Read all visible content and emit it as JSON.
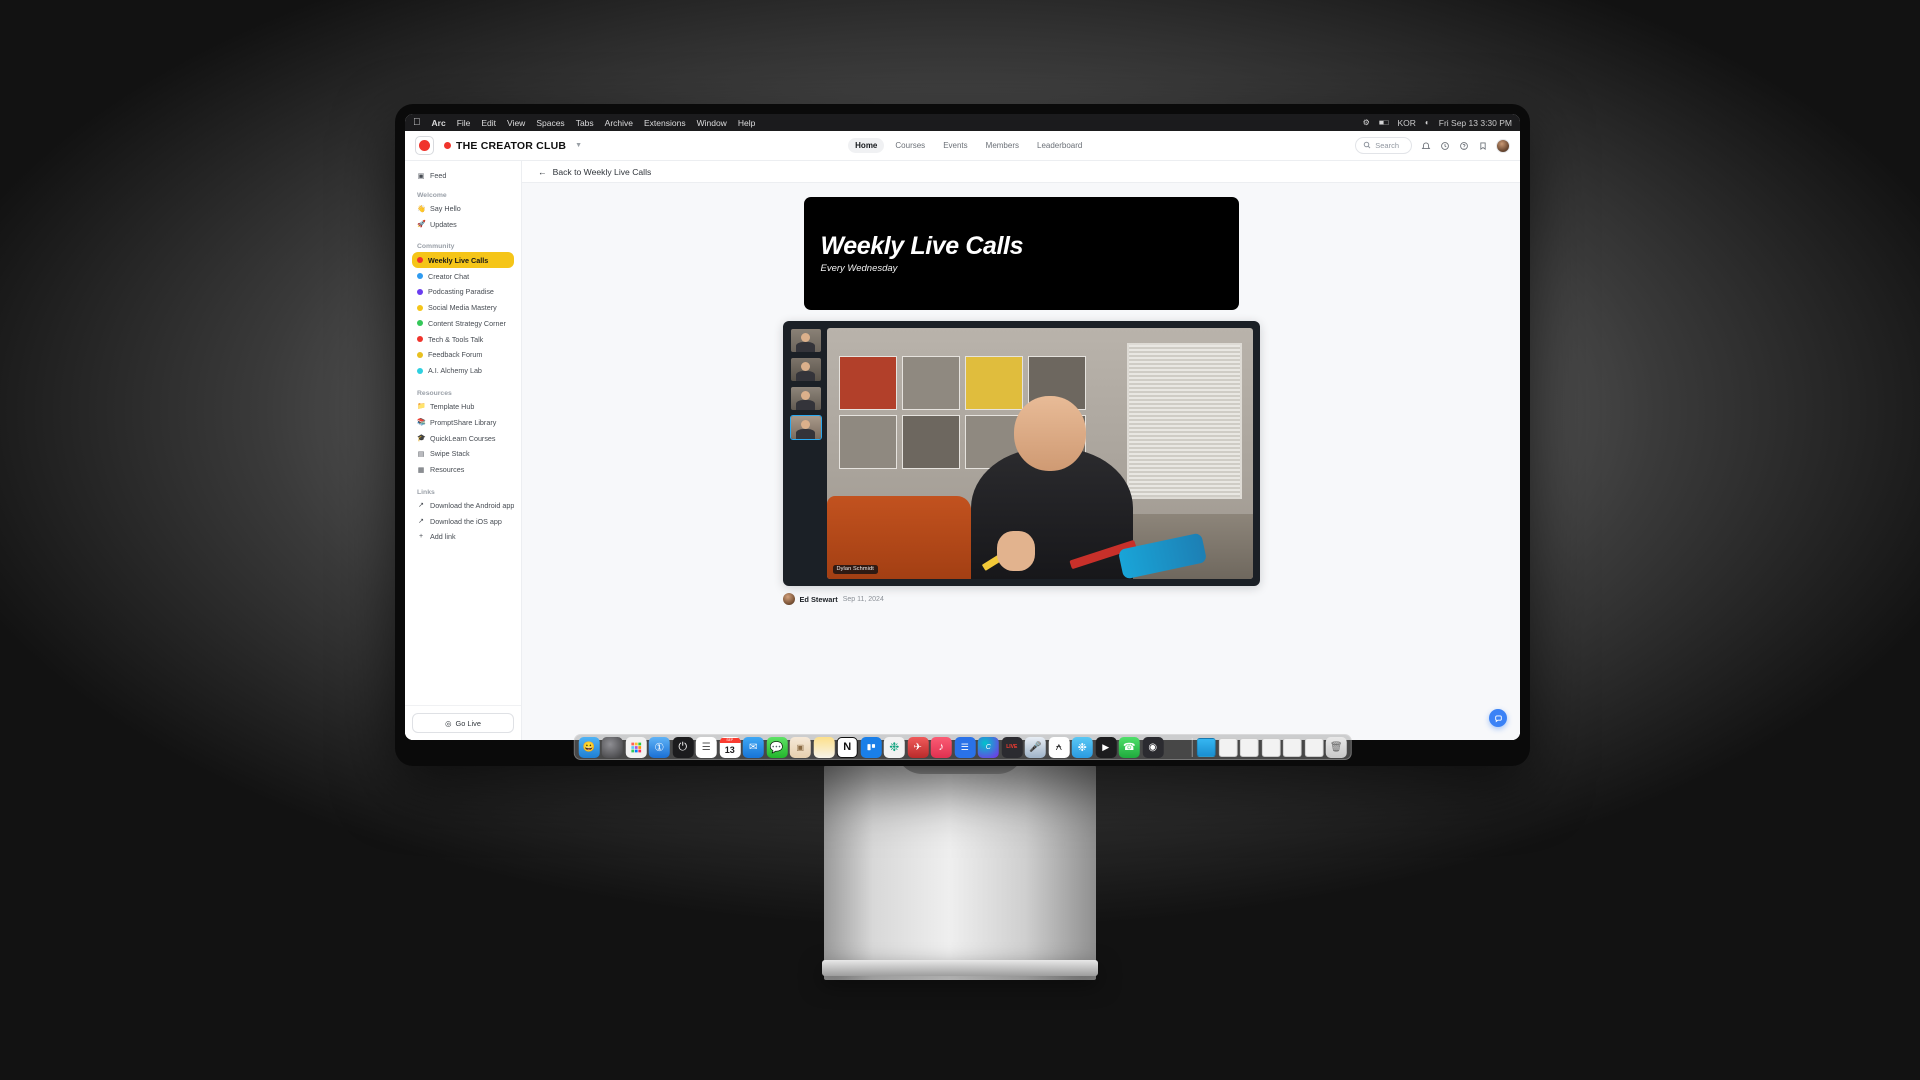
{
  "menubar": {
    "apple_icon": "apple-icon",
    "items": [
      "Arc",
      "File",
      "Edit",
      "View",
      "Spaces",
      "Tabs",
      "Archive",
      "Extensions",
      "Window",
      "Help"
    ],
    "status": {
      "battery_icon": "battery-icon",
      "control_center_icon": "control-center-icon",
      "wifi_icon": "wifi-icon",
      "input_label": "KOR",
      "datetime": "Fri Sep 13  3:30 PM"
    }
  },
  "app": {
    "brand": {
      "logo_icon": "record-dot-logo",
      "name": "THE CREATOR CLUB",
      "caret_icon": "chevron-down-icon"
    },
    "topnav": [
      {
        "label": "Home",
        "active": true
      },
      {
        "label": "Courses",
        "active": false
      },
      {
        "label": "Events",
        "active": false
      },
      {
        "label": "Members",
        "active": false
      },
      {
        "label": "Leaderboard",
        "active": false
      }
    ],
    "topright": {
      "search_placeholder": "Search",
      "search_icon": "search-icon",
      "icons": [
        "notifications-icon",
        "activity-icon",
        "help-icon",
        "bookmark-icon"
      ],
      "avatar": "user-avatar"
    }
  },
  "sidebar": {
    "feed": {
      "label": "Feed",
      "icon": "feed-icon"
    },
    "groups": [
      {
        "title": "Welcome",
        "items": [
          {
            "label": "Say Hello",
            "icon": "wave-emoji",
            "color": "#f5c518",
            "active": false
          },
          {
            "label": "Updates",
            "icon": "rocket-emoji",
            "color": "#e2503c",
            "active": false
          }
        ]
      },
      {
        "title": "Community",
        "items": [
          {
            "label": "Weekly Live Calls",
            "icon": "dot",
            "color": "#f0342c",
            "active": true
          },
          {
            "label": "Creator Chat",
            "icon": "dot",
            "color": "#2f9bf0",
            "active": false
          },
          {
            "label": "Podcasting Paradise",
            "icon": "dot",
            "color": "#6b3df0",
            "active": false
          },
          {
            "label": "Social Media Mastery",
            "icon": "dot",
            "color": "#f5c518",
            "active": false
          },
          {
            "label": "Content Strategy Corner",
            "icon": "dot",
            "color": "#34c759",
            "active": false
          },
          {
            "label": "Tech & Tools Talk",
            "icon": "dot",
            "color": "#f0342c",
            "active": false
          },
          {
            "label": "Feedback Forum",
            "icon": "dot",
            "color": "#e8c020",
            "active": false
          },
          {
            "label": "A.I. Alchemy Lab",
            "icon": "dot",
            "color": "#2fd0e0",
            "active": false
          }
        ]
      },
      {
        "title": "Resources",
        "items": [
          {
            "label": "Template Hub",
            "icon": "folder-icon",
            "color": "",
            "active": false
          },
          {
            "label": "PromptShare Library",
            "icon": "book-icon",
            "color": "",
            "active": false
          },
          {
            "label": "QuickLearn Courses",
            "icon": "graduation-icon",
            "color": "",
            "active": false
          },
          {
            "label": "Swipe Stack",
            "icon": "stack-icon",
            "color": "",
            "active": false
          },
          {
            "label": "Resources",
            "icon": "doc-icon",
            "color": "",
            "active": false
          }
        ]
      },
      {
        "title": "Links",
        "items": [
          {
            "label": "Download the Android app",
            "icon": "external-link-icon",
            "color": "",
            "active": false
          },
          {
            "label": "Download the iOS app",
            "icon": "external-link-icon",
            "color": "",
            "active": false
          },
          {
            "label": "Add link",
            "icon": "plus-icon",
            "color": "",
            "active": false
          }
        ]
      }
    ],
    "golive": {
      "label": "Go Live",
      "icon": "broadcast-icon"
    }
  },
  "content": {
    "breadcrumb": {
      "back_icon": "arrow-left-icon",
      "label": "Back to Weekly Live Calls"
    },
    "banner": {
      "title": "Weekly Live Calls",
      "subtitle": "Every Wednesday"
    },
    "player": {
      "active_speaker_name": "Dylan Schmidt",
      "thumbnails": [
        {
          "name": "participant-1",
          "active": false
        },
        {
          "name": "participant-2",
          "active": false
        },
        {
          "name": "participant-3",
          "active": false
        },
        {
          "name": "participant-4",
          "active": true
        }
      ]
    },
    "post": {
      "author": "Ed Stewart",
      "date": "Sep 11, 2024"
    },
    "fab_icon": "chat-bubble-icon"
  },
  "dock": {
    "items": [
      "finder",
      "arc",
      "launchpad",
      "1password",
      "power",
      "reminders",
      "calendar-13",
      "mail",
      "messages",
      "contacts",
      "notes",
      "notion",
      "trello",
      "chatgpt",
      "mail-app",
      "music",
      "todoist",
      "canva",
      "streamyard",
      "mic",
      "capcut",
      "loom",
      "screenflow",
      "whatsapp",
      "quicktime",
      "screens"
    ],
    "calendar_day": "13",
    "minis": [
      "window-1",
      "window-2",
      "window-3",
      "window-4",
      "window-5"
    ],
    "trash": "trash"
  }
}
